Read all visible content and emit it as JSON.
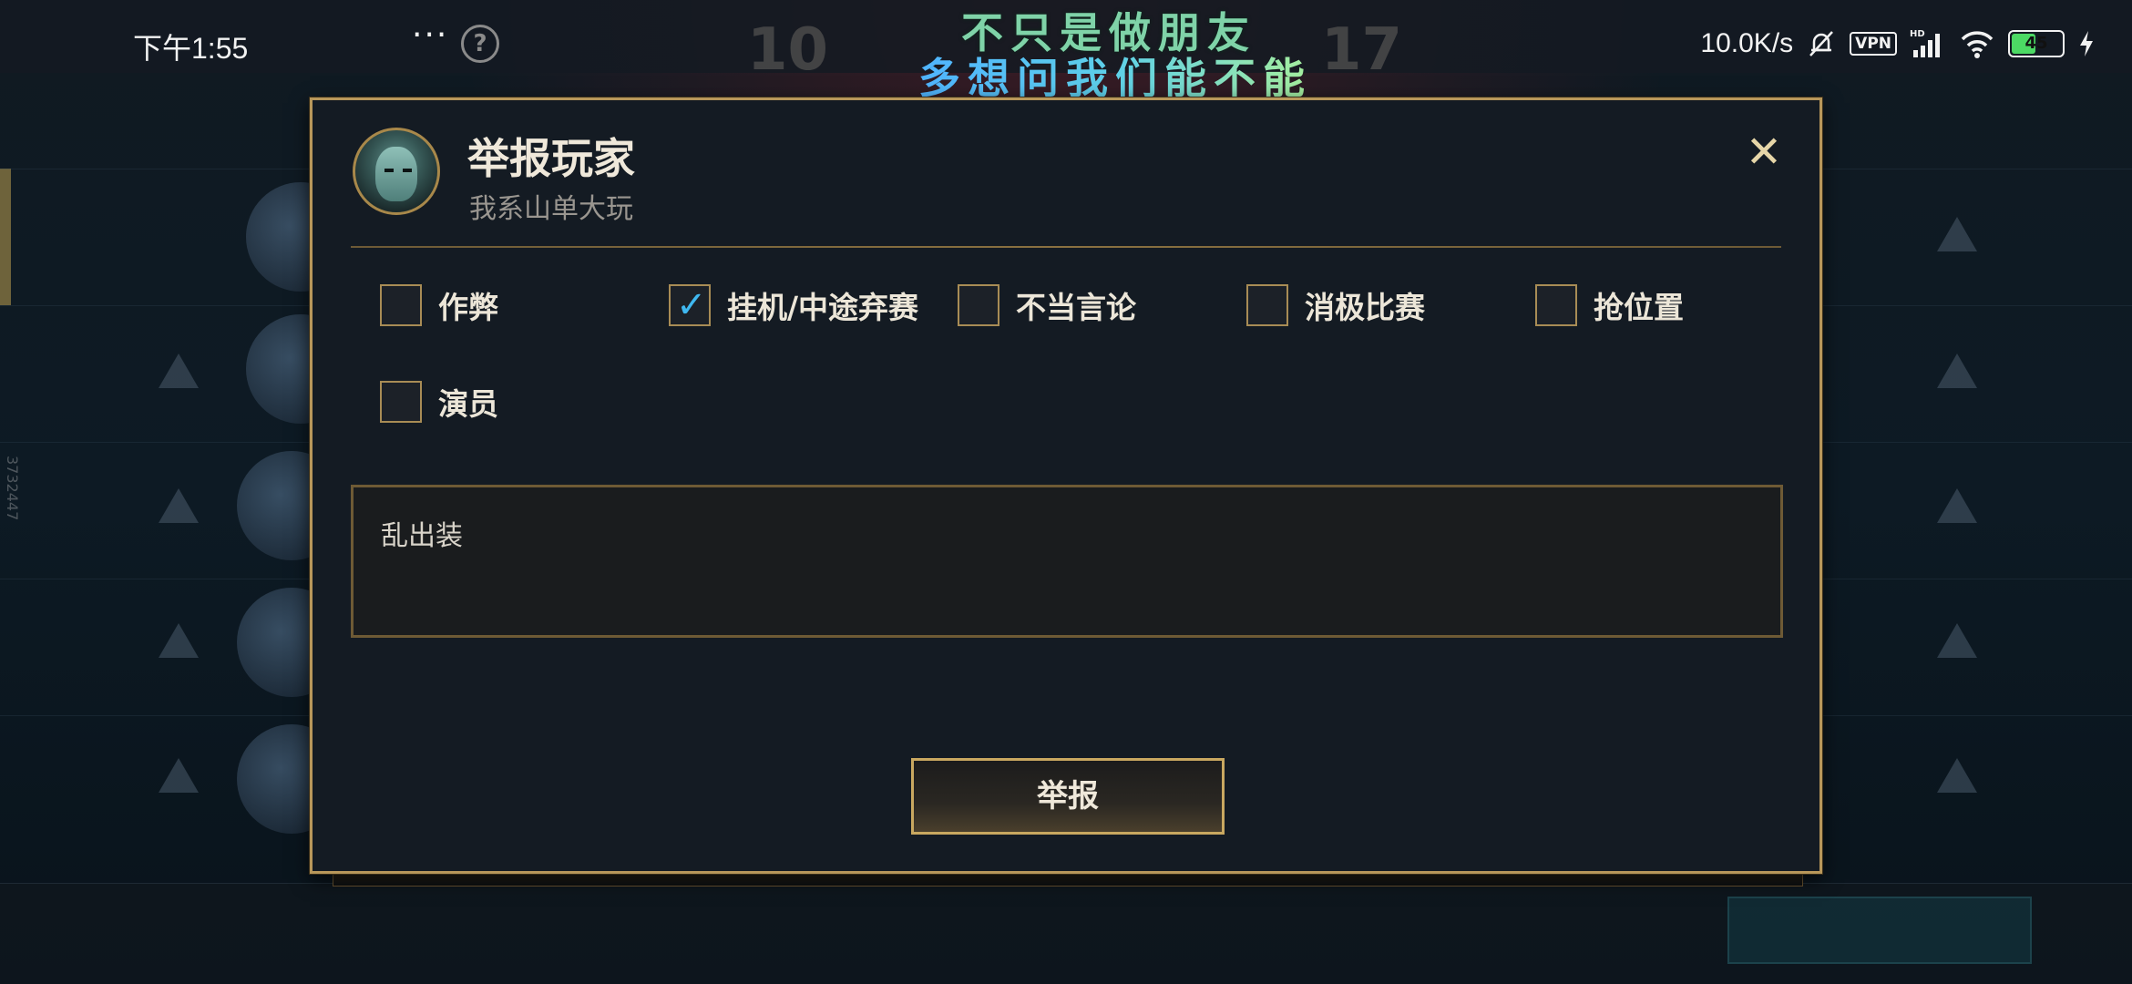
{
  "status_bar": {
    "time": "下午1:55",
    "more": "···",
    "help": "?",
    "net_speed": "10.0K/s",
    "vpn": "VPN",
    "battery_level": "45"
  },
  "lyrics": {
    "line1": "不只是做朋友",
    "line2": "多想问我们能不能"
  },
  "background": {
    "score_left": "10",
    "score_right": "17",
    "side_id": "3732447"
  },
  "dialog": {
    "title": "举报玩家",
    "player_name": "我系山单大玩",
    "close": "✕",
    "options": [
      {
        "label": "作弊",
        "checked": false
      },
      {
        "label": "挂机/中途弃赛",
        "checked": true
      },
      {
        "label": "不当言论",
        "checked": false
      },
      {
        "label": "消极比赛",
        "checked": false
      },
      {
        "label": "抢位置",
        "checked": false
      },
      {
        "label": "演员",
        "checked": false
      }
    ],
    "comment": "乱出装",
    "submit_label": "举报"
  },
  "colors": {
    "accent_gold": "#b8975a",
    "check_blue": "#3fb8f0",
    "dialog_bg": "#141b23"
  }
}
